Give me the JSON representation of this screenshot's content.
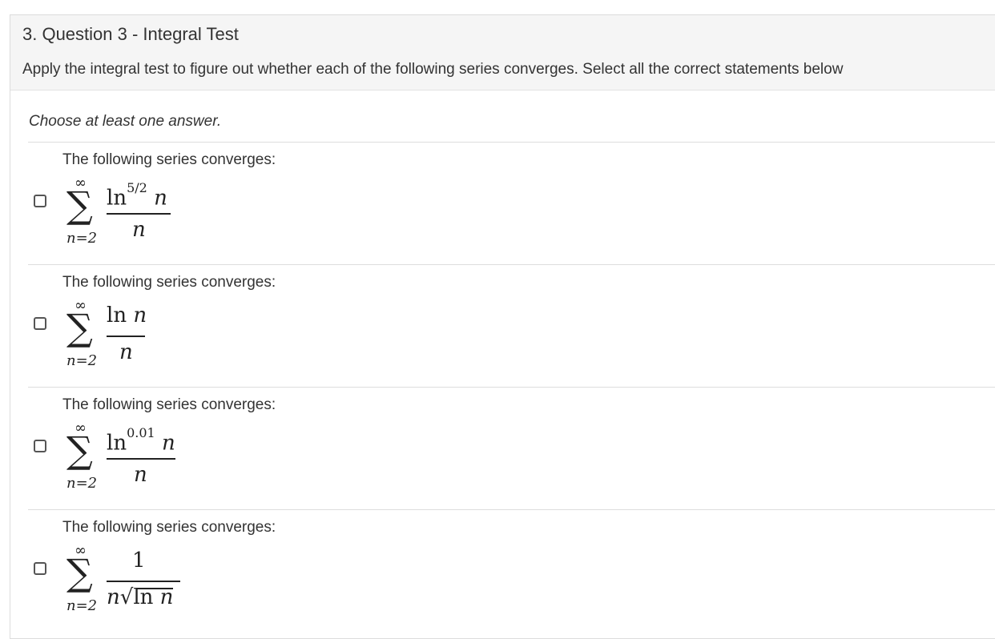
{
  "question": {
    "title": "3. Question 3 - Integral Test",
    "prompt": "Apply the integral test to figure out whether each of the following series converges. Select all the correct statements below",
    "instruction": "Choose at least one answer."
  },
  "answers": [
    {
      "label": "The following series converges:",
      "sum_upper": "∞",
      "sum_lower": "n=2",
      "numerator_fn": "ln",
      "numerator_exp": "5/2",
      "numerator_var": "n",
      "denominator": "n",
      "checked": false
    },
    {
      "label": "The following series converges:",
      "sum_upper": "∞",
      "sum_lower": "n=2",
      "numerator_fn": "ln",
      "numerator_exp": "",
      "numerator_var": "n",
      "denominator": "n",
      "checked": false
    },
    {
      "label": "The following series converges:",
      "sum_upper": "∞",
      "sum_lower": "n=2",
      "numerator_fn": "ln",
      "numerator_exp": "0.01",
      "numerator_var": "n",
      "denominator": "n",
      "checked": false
    },
    {
      "label": "The following series converges:",
      "sum_upper": "∞",
      "sum_lower": "n=2",
      "numerator_text": "1",
      "denominator_var": "n",
      "denominator_radical_symbol": "√",
      "denominator_radicand_fn": "ln",
      "denominator_radicand_var": "n",
      "checked": false
    }
  ]
}
